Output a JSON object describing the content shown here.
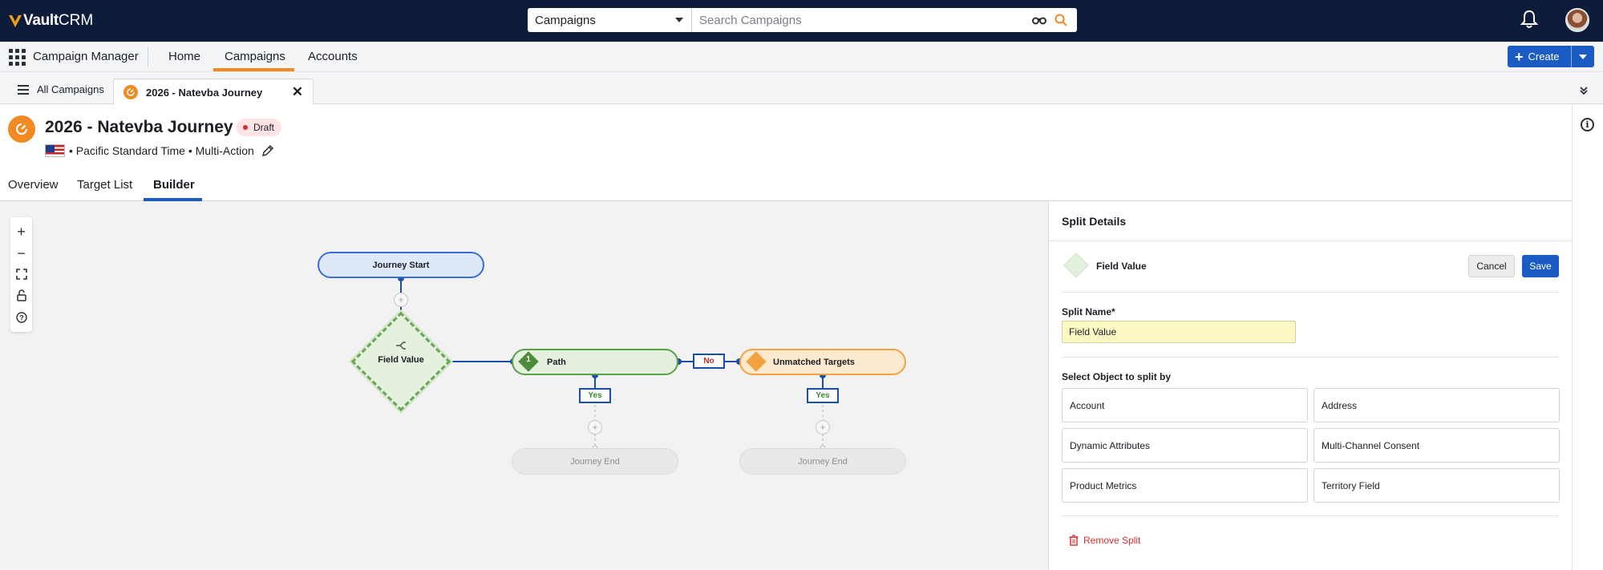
{
  "app": {
    "logo_vault": "Vault",
    "logo_crm": "CRM",
    "name": "Campaign Manager"
  },
  "search": {
    "scope": "Campaigns",
    "placeholder": "Search Campaigns"
  },
  "nav": {
    "items": [
      "Home",
      "Campaigns",
      "Accounts"
    ],
    "active": "Campaigns",
    "create_label": "Create"
  },
  "tabs": {
    "all_label": "All Campaigns",
    "open_tab": "2026 - Natevba Journey"
  },
  "header": {
    "title": "2026 - Natevba Journey",
    "status": "Draft",
    "subinfo": "• Pacific Standard Time • Multi-Action"
  },
  "subtabs": [
    "Overview",
    "Target List",
    "Builder"
  ],
  "active_subtab": "Builder",
  "flow": {
    "start": "Journey Start",
    "split": "Field Value",
    "path_number": "1",
    "path": "Path",
    "no": "No",
    "unmatched": "Unmatched Targets",
    "yes": "Yes",
    "end": "Journey End"
  },
  "panel": {
    "title": "Split Details",
    "type_label": "Field Value",
    "cancel": "Cancel",
    "save": "Save",
    "split_name_label": "Split Name*",
    "split_name_value": "Field Value",
    "object_label": "Select Object to split by",
    "objects": [
      "Account",
      "Address",
      "Dynamic Attributes",
      "Multi-Channel Consent",
      "Product Metrics",
      "Territory Field"
    ],
    "remove": "Remove Split"
  },
  "colors": {
    "topbar": "#0c1c3a",
    "accent_orange": "#f08a24",
    "primary_blue": "#1a5bc4",
    "danger_red": "#d32f2f"
  }
}
